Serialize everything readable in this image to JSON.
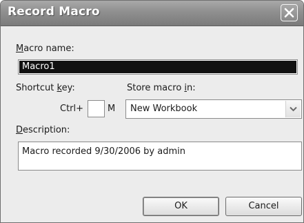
{
  "dialog": {
    "title": "Record Macro"
  },
  "macro_name": {
    "label_mnemonic": "M",
    "label_rest": "acro name:",
    "value": "Macro1"
  },
  "shortcut": {
    "label_prefix": "Shortcut ",
    "label_mnemonic": "k",
    "label_suffix": "ey:",
    "ctrl_label": "Ctrl+",
    "key_value": "",
    "suffix_letter": "M"
  },
  "store_in": {
    "label_prefix": "Store macro ",
    "label_mnemonic": "i",
    "label_suffix": "n:",
    "selected": "New Workbook"
  },
  "description": {
    "label_mnemonic": "D",
    "label_rest": "escription:",
    "value": "Macro recorded 9/30/2006 by admin"
  },
  "buttons": {
    "ok": "OK",
    "cancel": "Cancel"
  },
  "icons": {
    "close": "close-icon",
    "dropdown": "chevron-down-icon"
  }
}
